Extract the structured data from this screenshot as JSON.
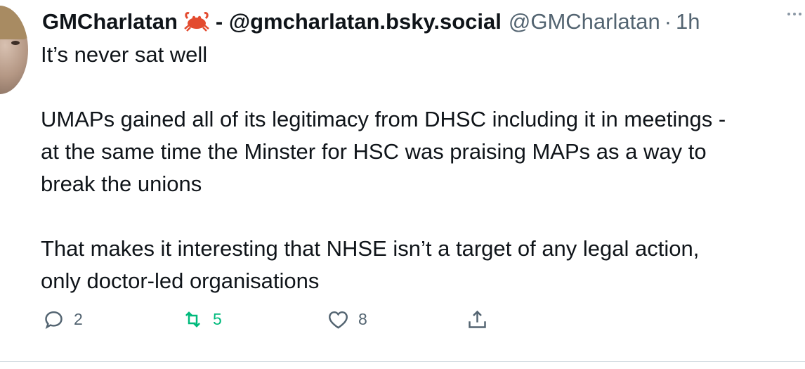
{
  "author": {
    "name": "GMCharlatan",
    "handle_bold": "- @gmcharlatan.bsky.social",
    "handle": "@GMCharlatan",
    "dot": "·",
    "time": "1h"
  },
  "tweet": {
    "text": "It’s never sat well\n\nUMAPs gained all of its legitimacy from DHSC including it in meetings -\nat the same time the Minster for HSC was praising MAPs as a way to\nbreak the unions\n\nThat makes it interesting that NHSE isn’t a target of any legal action,\nonly doctor-led organisations"
  },
  "actions": {
    "reply_count": "2",
    "retweet_count": "5",
    "like_count": "8"
  },
  "colors": {
    "text": "#0f1419",
    "secondary": "#536471",
    "retweet": "#00ba7c",
    "divider": "#cfd9de"
  },
  "icons": [
    "crab-emoji-icon",
    "more-icon",
    "reply-icon",
    "retweet-icon",
    "like-icon",
    "share-icon"
  ]
}
